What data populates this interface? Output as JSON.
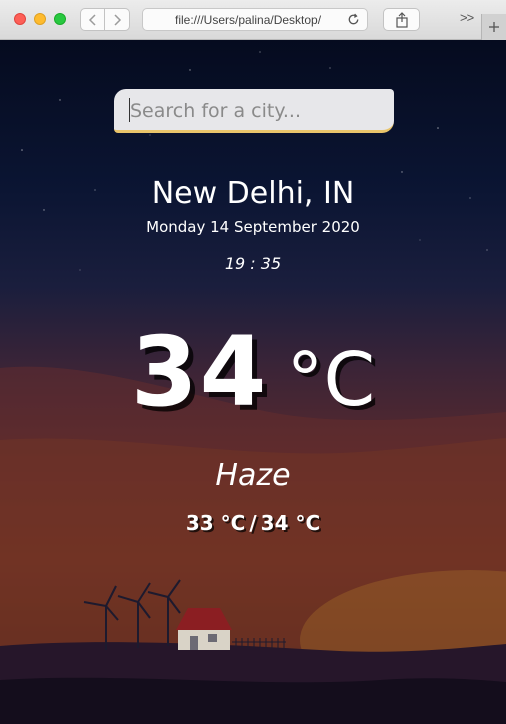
{
  "browser": {
    "url": "file:///Users/palina/Desktop/",
    "overflow": ">>",
    "new_tab": "+"
  },
  "search": {
    "placeholder": "Search for a city...",
    "value": ""
  },
  "location": {
    "city": "New Delhi, IN",
    "date": "Monday 14 September 2020",
    "time": "19 : 35"
  },
  "weather": {
    "temperature": "34",
    "unit": "°C",
    "condition": "Haze",
    "min": "33 °C",
    "separator": "/",
    "max": "34 °C"
  },
  "colors": {
    "search_accent": "#e9c46a",
    "search_bg": "#e7e7ea",
    "sky_top": "#050b1f",
    "sky_bottom": "#6e3320"
  }
}
